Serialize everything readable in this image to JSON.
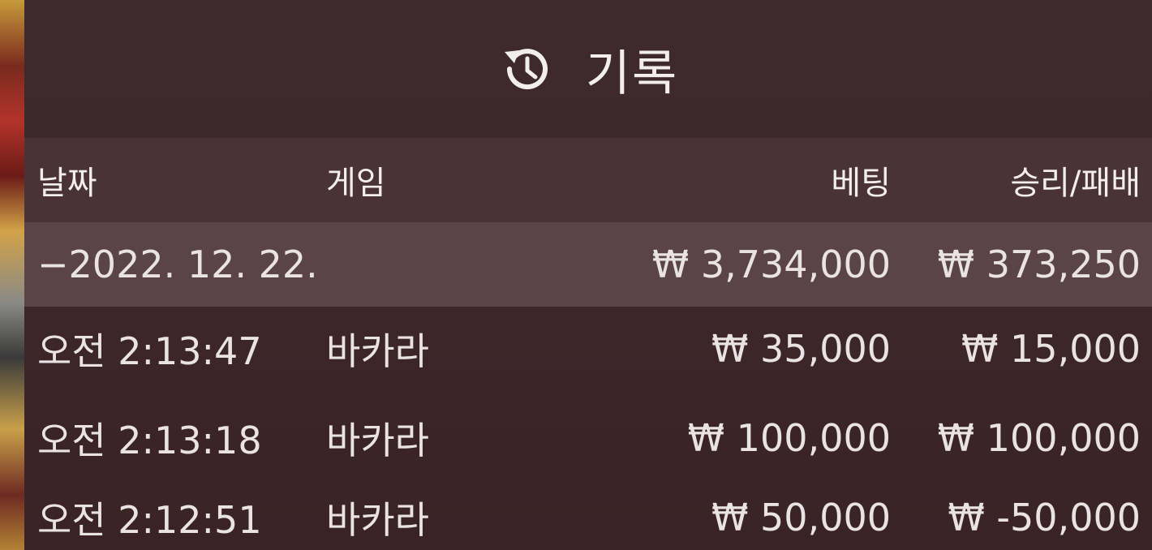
{
  "header": {
    "title": "기록",
    "icon": "history-icon"
  },
  "columns": {
    "date": "날짜",
    "game": "게임",
    "bet": "베팅",
    "result": "승리/패배"
  },
  "summary": {
    "date": "−2022. 12. 22.",
    "bet": "₩ 3,734,000",
    "result": "₩ 373,250"
  },
  "rows": [
    {
      "time": "오전 2:13:47",
      "game": "바카라",
      "bet": "₩ 35,000",
      "result": "₩ 15,000"
    },
    {
      "time": "오전 2:13:18",
      "game": "바카라",
      "bet": "₩ 100,000",
      "result": "₩ 100,000"
    },
    {
      "time": "오전 2:12:51",
      "game": "바카라",
      "bet": "₩ 50,000",
      "result": "₩ -50,000"
    }
  ],
  "colors": {
    "panel": "#3a2326",
    "header_row": "#4a3336",
    "summary_row": "#5a4447",
    "text": "#f1ecec"
  }
}
